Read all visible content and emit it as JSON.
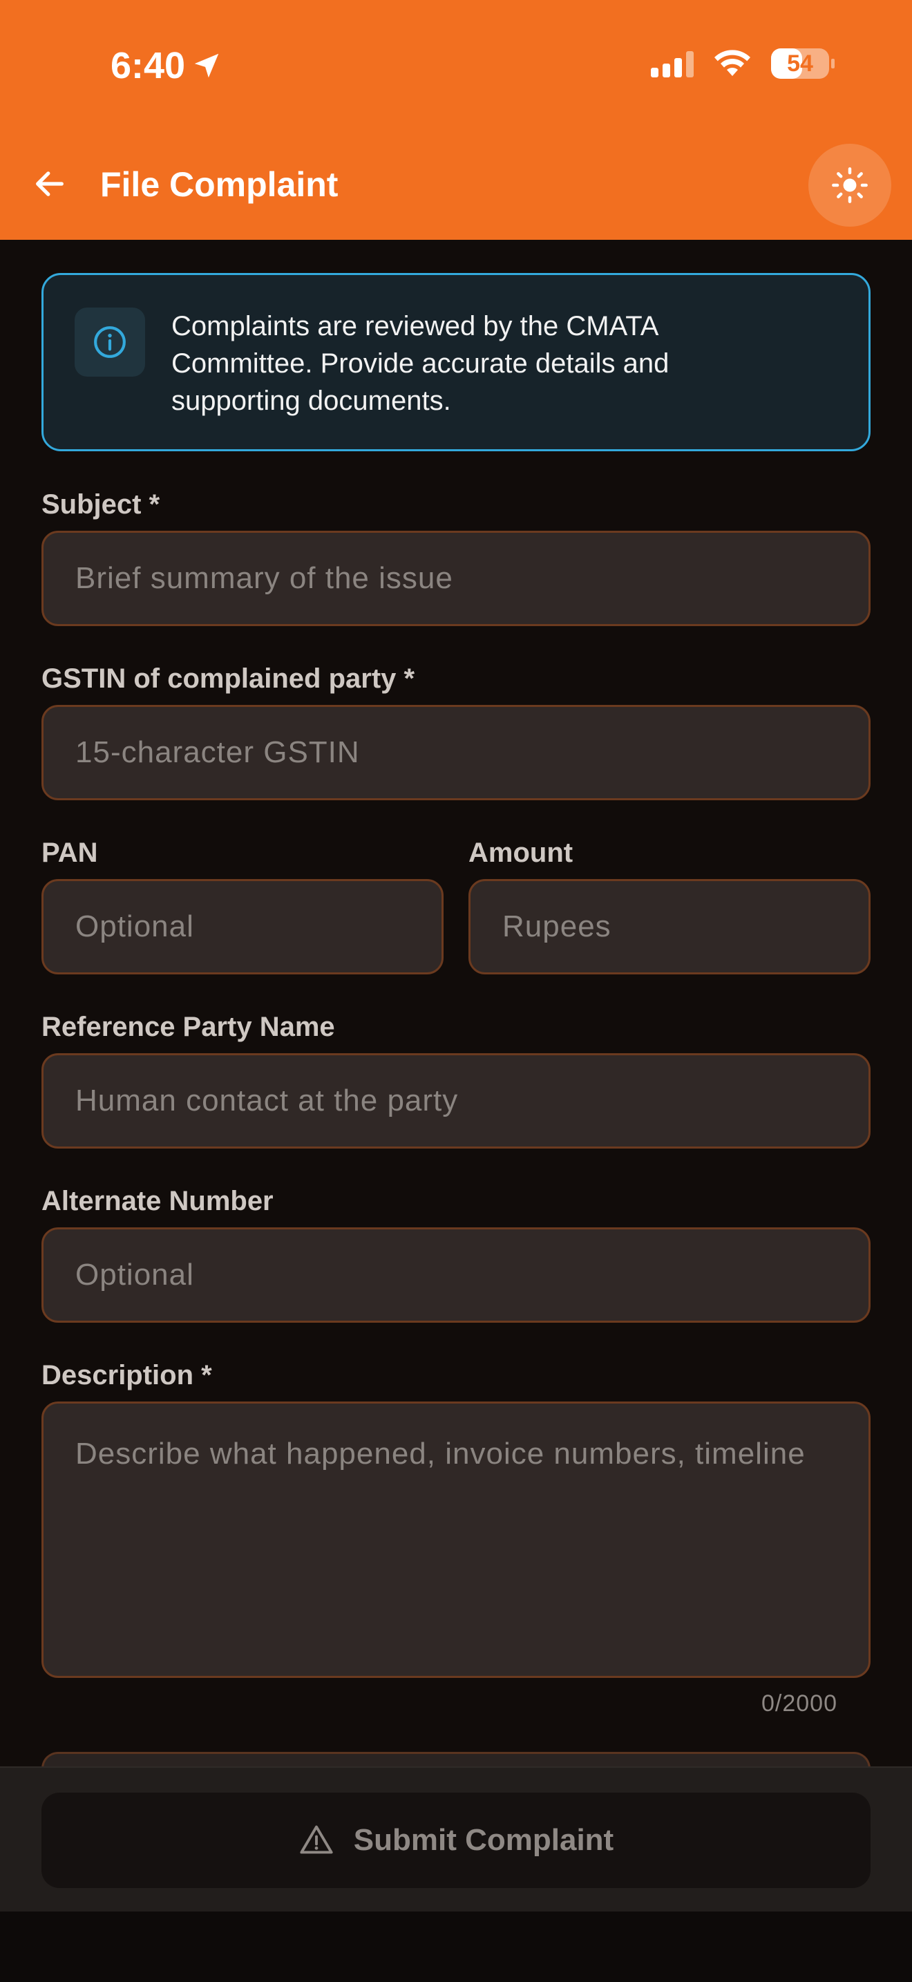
{
  "status_bar": {
    "time": "6:40",
    "battery_percent": "54",
    "battery_level": 0.54
  },
  "header": {
    "title": "File Complaint",
    "back_icon": "arrow-left-icon",
    "theme_icon": "sun-icon",
    "accent_color": "#f26f20"
  },
  "info": {
    "icon": "info-icon",
    "text": "Complaints are reviewed by the CMATA Committee. Provide accurate details and supporting documents.",
    "border_color": "#33a9dc"
  },
  "form": {
    "subject": {
      "label": "Subject *",
      "placeholder": "Brief summary of the issue",
      "value": ""
    },
    "gstin": {
      "label": "GSTIN of complained party *",
      "placeholder": "15-character GSTIN",
      "value": ""
    },
    "pan": {
      "label": "PAN",
      "placeholder": "Optional",
      "value": ""
    },
    "amount": {
      "label": "Amount",
      "placeholder": "Rupees",
      "value": ""
    },
    "reference_party": {
      "label": "Reference Party Name",
      "placeholder": "Human contact at the party",
      "value": ""
    },
    "alternate_number": {
      "label": "Alternate Number",
      "placeholder": "Optional",
      "value": ""
    },
    "description": {
      "label": "Description *",
      "placeholder": "Describe what happened, invoice numbers, timeline",
      "value": "",
      "counter": "0/2000"
    }
  },
  "footer": {
    "submit_label": "Submit Complaint",
    "submit_icon": "warning-triangle-icon"
  }
}
